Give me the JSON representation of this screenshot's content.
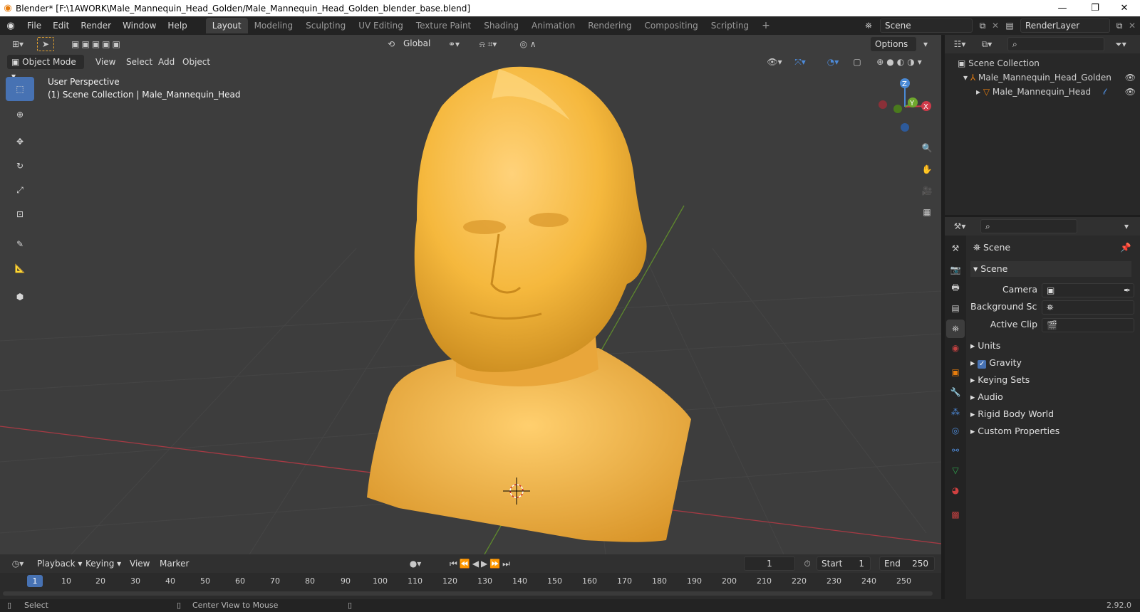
{
  "window": {
    "title": "Blender* [F:\\1AWORK\\Male_Mannequin_Head_Golden/Male_Mannequin_Head_Golden_blender_base.blend]",
    "minimize_glyph": "—",
    "maximize_glyph": "❐",
    "close_glyph": "✕"
  },
  "menubar": {
    "items": [
      "File",
      "Edit",
      "Render",
      "Window",
      "Help"
    ]
  },
  "workspaces": {
    "tabs": [
      "Layout",
      "Modeling",
      "Sculpting",
      "UV Editing",
      "Texture Paint",
      "Shading",
      "Animation",
      "Rendering",
      "Compositing",
      "Scripting"
    ],
    "active": "Layout",
    "add_glyph": "+"
  },
  "scene_selector": {
    "value": "Scene"
  },
  "viewlayer_selector": {
    "value": "RenderLayer"
  },
  "tool_header": {
    "orientation": "Global",
    "options_label": "Options"
  },
  "viewport_header": {
    "mode": "Object Mode",
    "menus": [
      "View",
      "Select",
      "Add",
      "Object"
    ]
  },
  "viewport": {
    "perspective": "User Perspective",
    "collection_info": "(1) Scene Collection | Male_Mannequin_Head",
    "gizmo": {
      "x": "X",
      "y": "Y",
      "z": "Z"
    },
    "colors": {
      "bg": "#3d3d3d",
      "mesh": "#f5b83d",
      "x_axis": "#a83a44",
      "y_axis": "#5f8a2d"
    }
  },
  "outliner": {
    "root": "Scene Collection",
    "items": [
      {
        "label": "Male_Mannequin_Head_Golden",
        "type": "armature"
      },
      {
        "label": "Male_Mannequin_Head",
        "type": "mesh"
      }
    ]
  },
  "properties": {
    "context": "Scene",
    "panel": "Scene",
    "fields": [
      {
        "label": "Camera",
        "value": ""
      },
      {
        "label": "Background Sce...",
        "value": ""
      },
      {
        "label": "Active Clip",
        "value": ""
      }
    ],
    "subpanels": [
      {
        "label": "Units",
        "checkbox": false
      },
      {
        "label": "Gravity",
        "checkbox": true
      },
      {
        "label": "Keying Sets",
        "checkbox": false
      },
      {
        "label": "Audio",
        "checkbox": false
      },
      {
        "label": "Rigid Body World",
        "checkbox": false
      },
      {
        "label": "Custom Properties",
        "checkbox": false
      }
    ]
  },
  "timeline": {
    "menus": [
      "Playback",
      "Keying",
      "View",
      "Marker"
    ],
    "current_frame": "1",
    "start_label": "Start",
    "start": "1",
    "end_label": "End",
    "end": "250",
    "ruler": [
      "1",
      "10",
      "20",
      "30",
      "40",
      "50",
      "60",
      "70",
      "80",
      "90",
      "100",
      "110",
      "120",
      "130",
      "140",
      "150",
      "160",
      "170",
      "180",
      "190",
      "200",
      "210",
      "220",
      "230",
      "240",
      "250"
    ]
  },
  "statusbar": {
    "left_action": "Select",
    "middle_action": "Center View to Mouse",
    "version": "2.92.0"
  }
}
